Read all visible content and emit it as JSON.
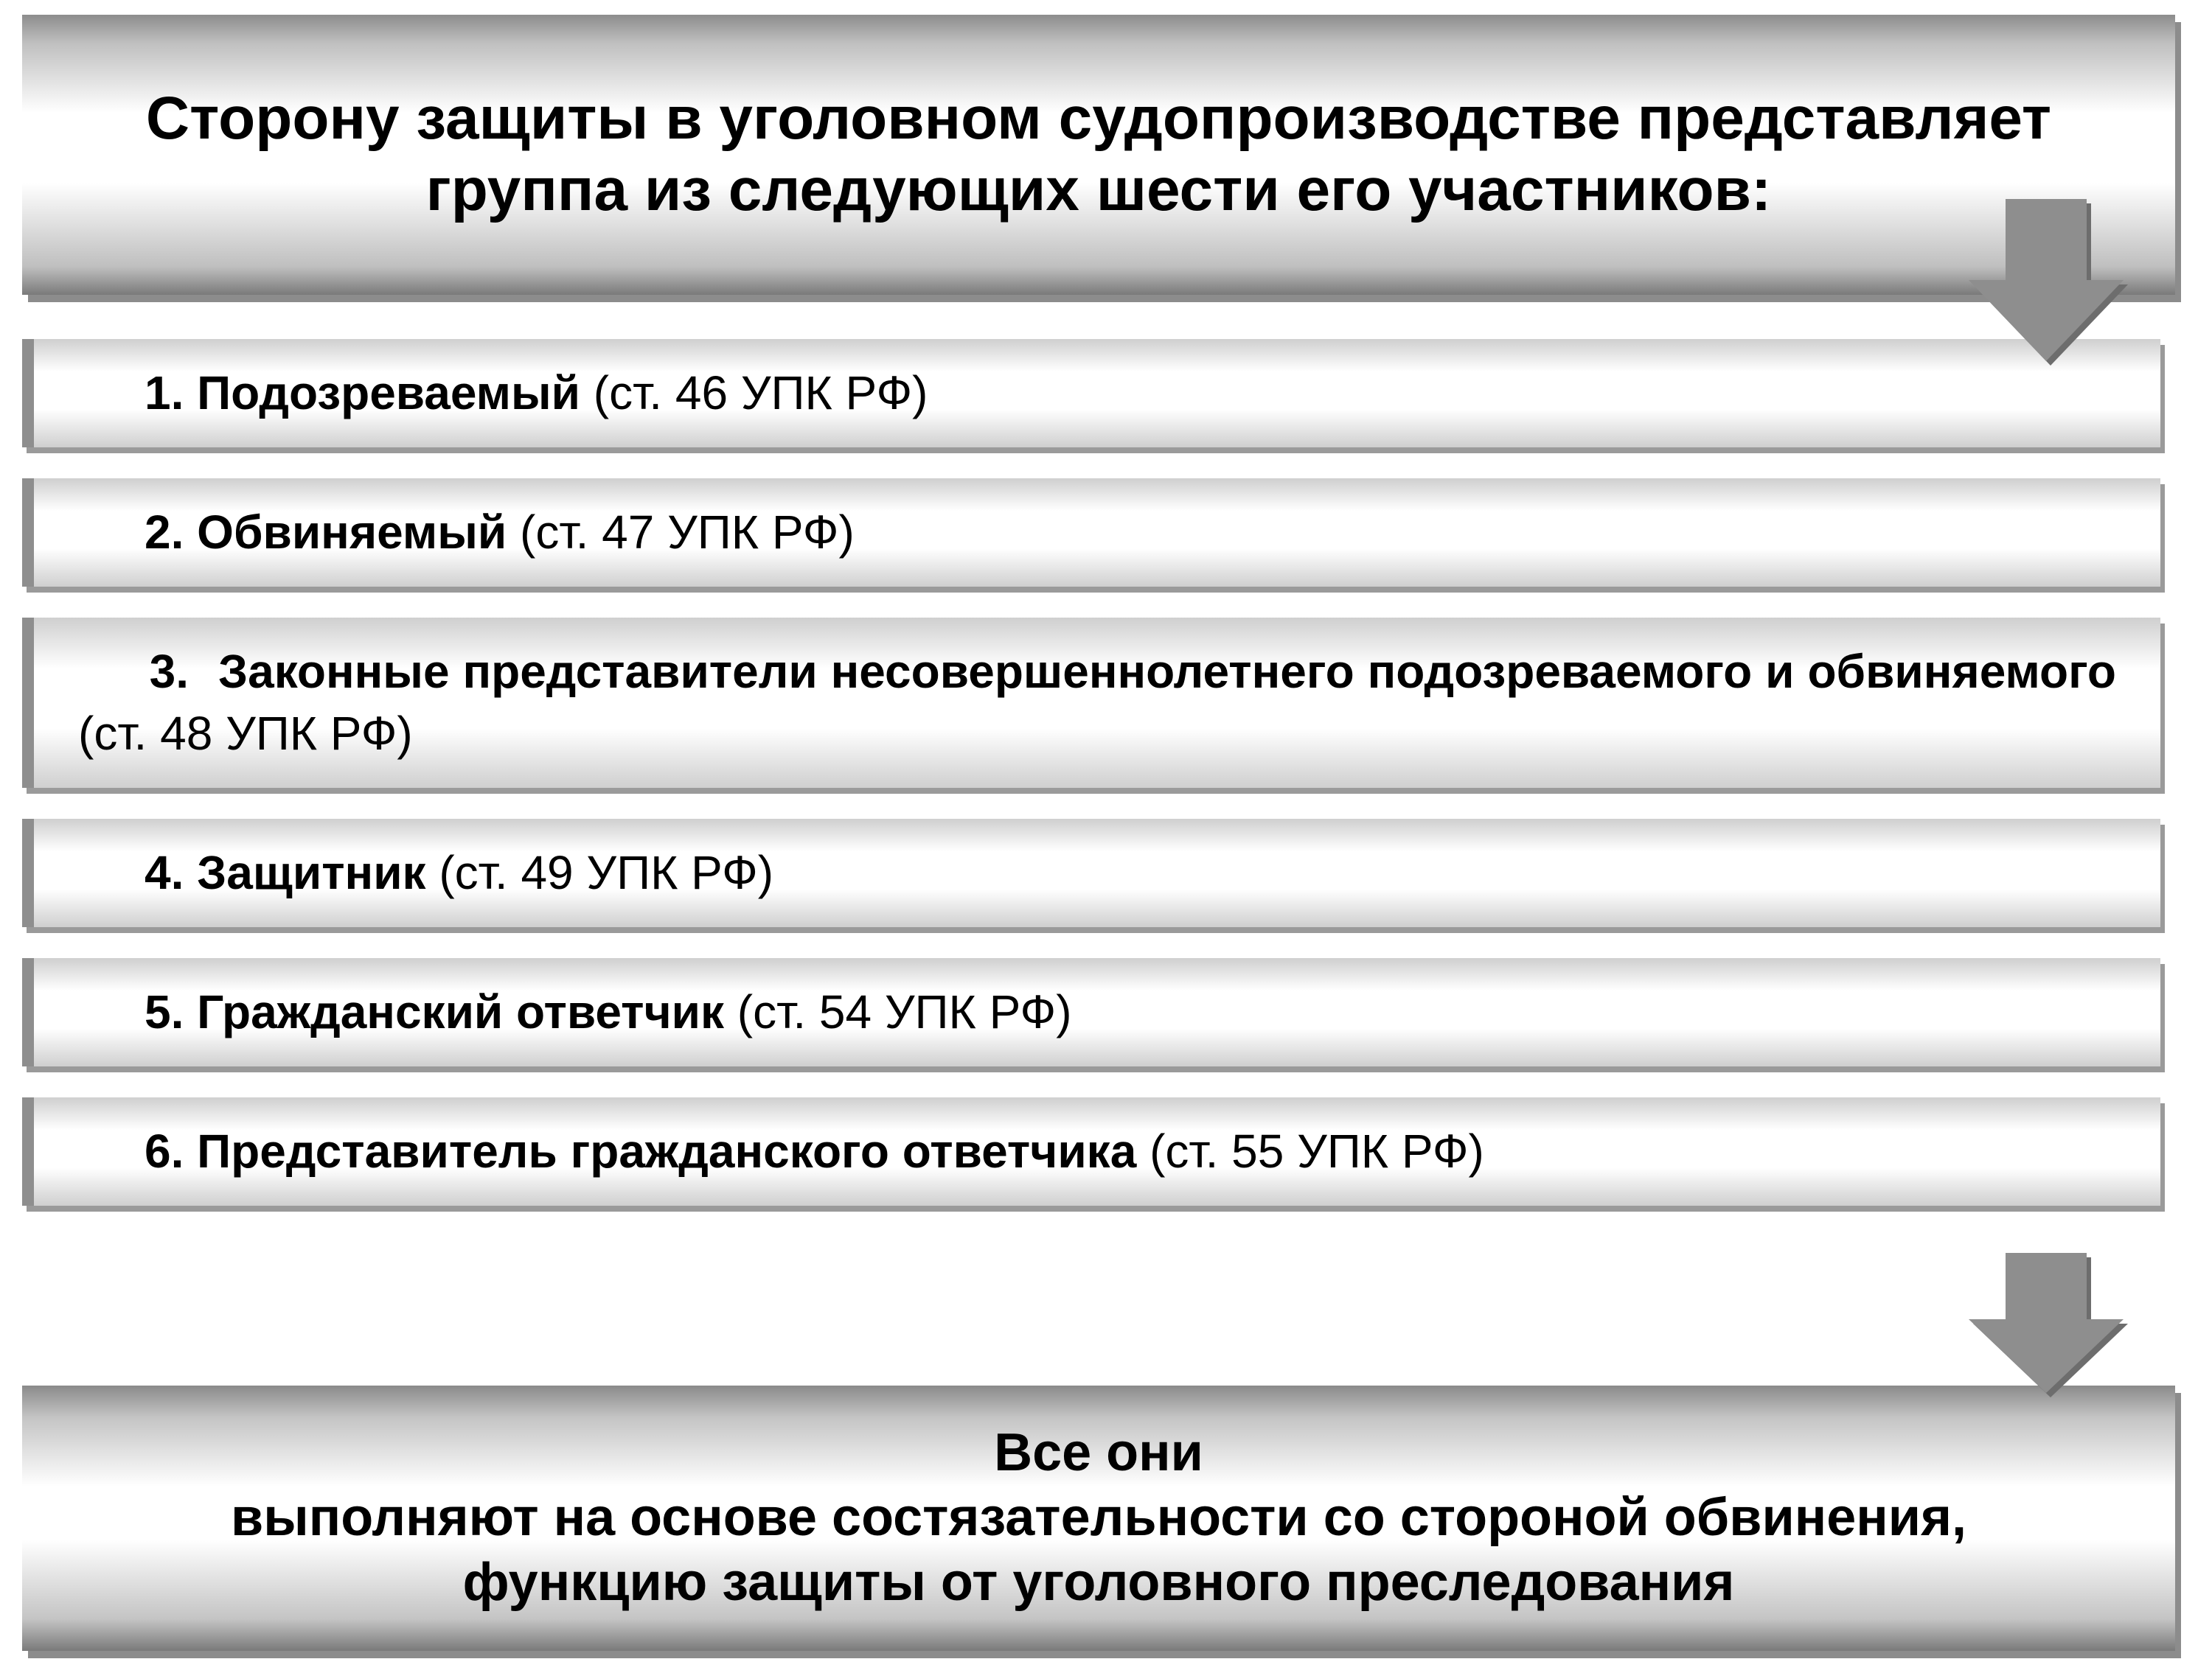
{
  "header": {
    "title": "Сторону защиты в уголовном судопроизводстве представляет группа из следующих шести его участников:"
  },
  "items": [
    {
      "num": "1.",
      "bold": "Подозреваемый",
      "ref": " (ст. 46 УПК РФ)"
    },
    {
      "num": "2.",
      "bold": "Обвиняемый",
      "ref": " (ст. 47 УПК РФ)"
    },
    {
      "num": "3.",
      "bold": "Законные представители несовершеннолетнего подозреваемого и обвиняемого",
      "ref": " (ст. 48 УПК РФ)",
      "justify": true
    },
    {
      "num": "4.",
      "bold": "Защитник",
      "ref": " (ст. 49 УПК РФ)"
    },
    {
      "num": "5.",
      "bold": "Гражданский ответчик",
      "ref": " (ст. 54 УПК РФ)"
    },
    {
      "num": "6.",
      "bold": "Представитель гражданского ответчика",
      "ref": " (ст. 55 УПК РФ)"
    }
  ],
  "footer": {
    "lead": "Все они",
    "rest": "выполняют на основе состязательности со стороной обвинения, функцию защиты от уголовного преследования"
  }
}
